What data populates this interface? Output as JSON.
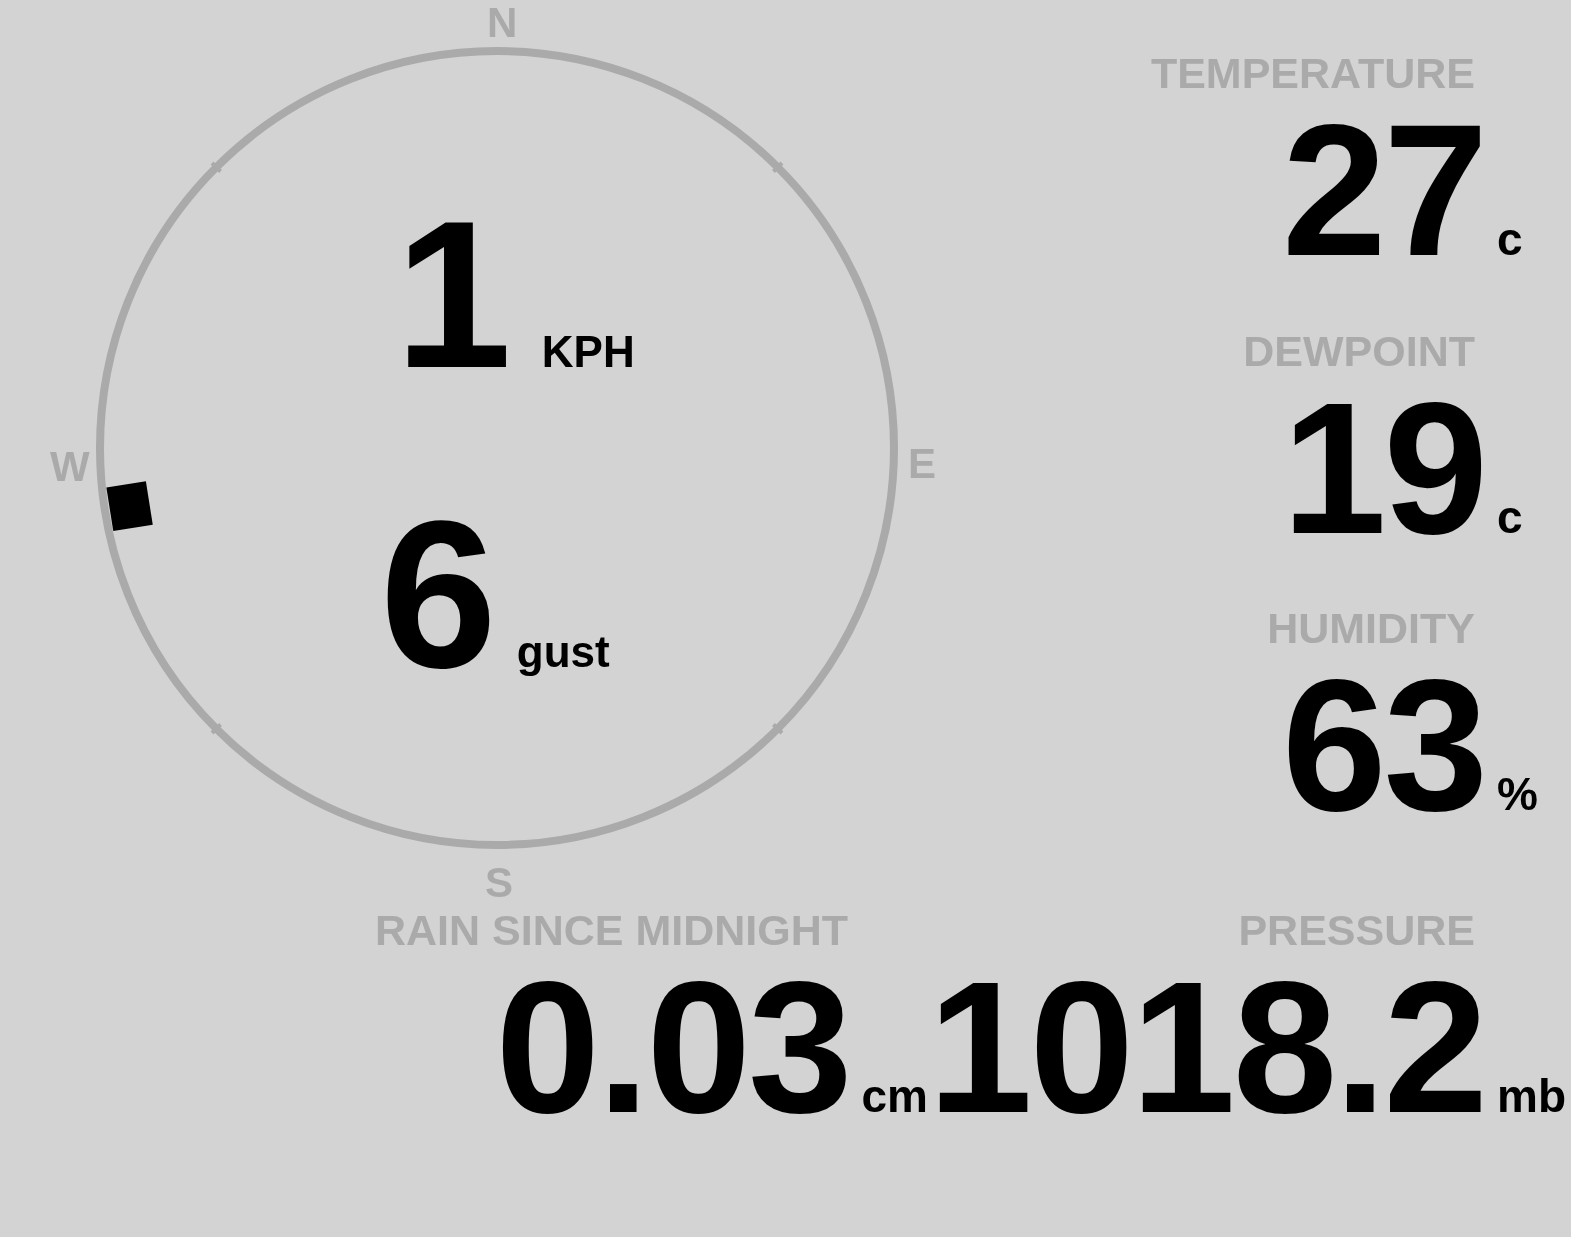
{
  "compass": {
    "north": "N",
    "east": "E",
    "south": "S",
    "west": "W"
  },
  "wind": {
    "speed": "1",
    "speed_unit": "KPH",
    "gust": "6",
    "gust_label": "gust"
  },
  "readings": [
    {
      "label": "TEMPERATURE",
      "value": "27",
      "unit": "c"
    },
    {
      "label": "DEWPOINT",
      "value": "19",
      "unit": "c"
    },
    {
      "label": "HUMIDITY",
      "value": "63",
      "unit": "%"
    }
  ],
  "rain": {
    "label": "RAIN SINCE MIDNIGHT",
    "value": "0.03",
    "unit": "cm"
  },
  "pressure": {
    "label": "PRESSURE",
    "value": "1018.2",
    "unit": "mb"
  }
}
